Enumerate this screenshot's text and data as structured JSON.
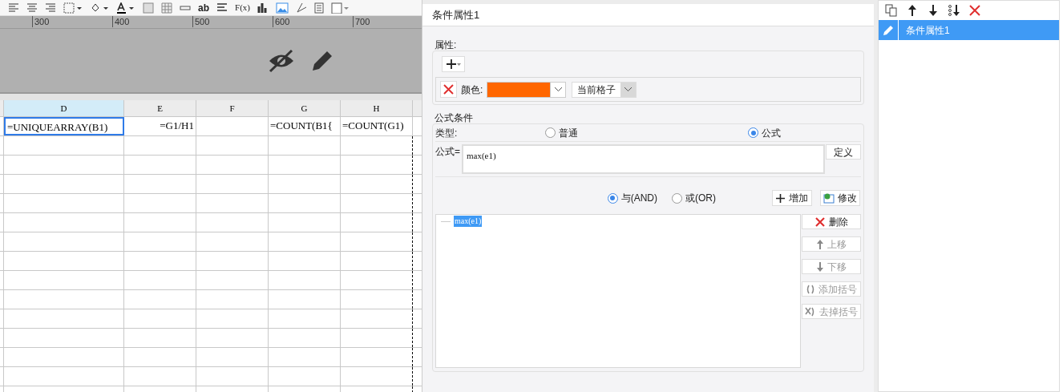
{
  "toolbar": {
    "labels": [
      "ab",
      "F(x)"
    ]
  },
  "ruler": {
    "ticks": [
      "300",
      "400",
      "500",
      "600",
      "700"
    ]
  },
  "sheet": {
    "columns": [
      {
        "label": "D",
        "selected": true
      },
      {
        "label": "E",
        "selected": false
      },
      {
        "label": "F",
        "selected": false
      },
      {
        "label": "G",
        "selected": false
      },
      {
        "label": "H",
        "selected": false
      }
    ],
    "rows": [
      {
        "cells": [
          {
            "text": "=UNIQUEARRAY(B1)",
            "selected": true
          },
          {
            "text": "=G1/H1",
            "selected": false
          },
          {
            "selected": false
          },
          {
            "text": "=COUNT(B1{",
            "selected": false
          },
          {
            "text": "=COUNT(G1)",
            "selected": false
          }
        ]
      }
    ]
  },
  "dialog": {
    "title": "条件属性1",
    "properties": {
      "legend": "属性:",
      "rows": [
        {
          "label": "颜色:",
          "color": "#ff6600",
          "scope": "当前格子"
        }
      ]
    },
    "formula_condition": {
      "legend": "公式条件",
      "type_label": "类型:",
      "types": [
        {
          "label": "普通",
          "selected": false
        },
        {
          "label": "公式",
          "selected": true
        }
      ],
      "formula_label": "公式=",
      "formula_value": "max(e1)",
      "define_button": "定义",
      "logic": [
        {
          "label": "与(AND)",
          "selected": true
        },
        {
          "label": "或(OR)",
          "selected": false
        }
      ],
      "add_button": "增加",
      "modify_button": "修改",
      "conditions": [
        {
          "text": "max(e1)",
          "selected": true
        }
      ],
      "side_buttons": [
        {
          "kind": "delete",
          "label": "删除",
          "disabled": false
        },
        {
          "kind": "up",
          "label": "上移",
          "disabled": true
        },
        {
          "kind": "down",
          "label": "下移",
          "disabled": true
        },
        {
          "kind": "add-brackets",
          "label": "添加括号",
          "disabled": true
        },
        {
          "kind": "remove-brackets",
          "label": "去掉括号",
          "disabled": true
        }
      ]
    }
  },
  "list": {
    "items": [
      {
        "label": "条件属性1",
        "selected": true
      }
    ]
  }
}
